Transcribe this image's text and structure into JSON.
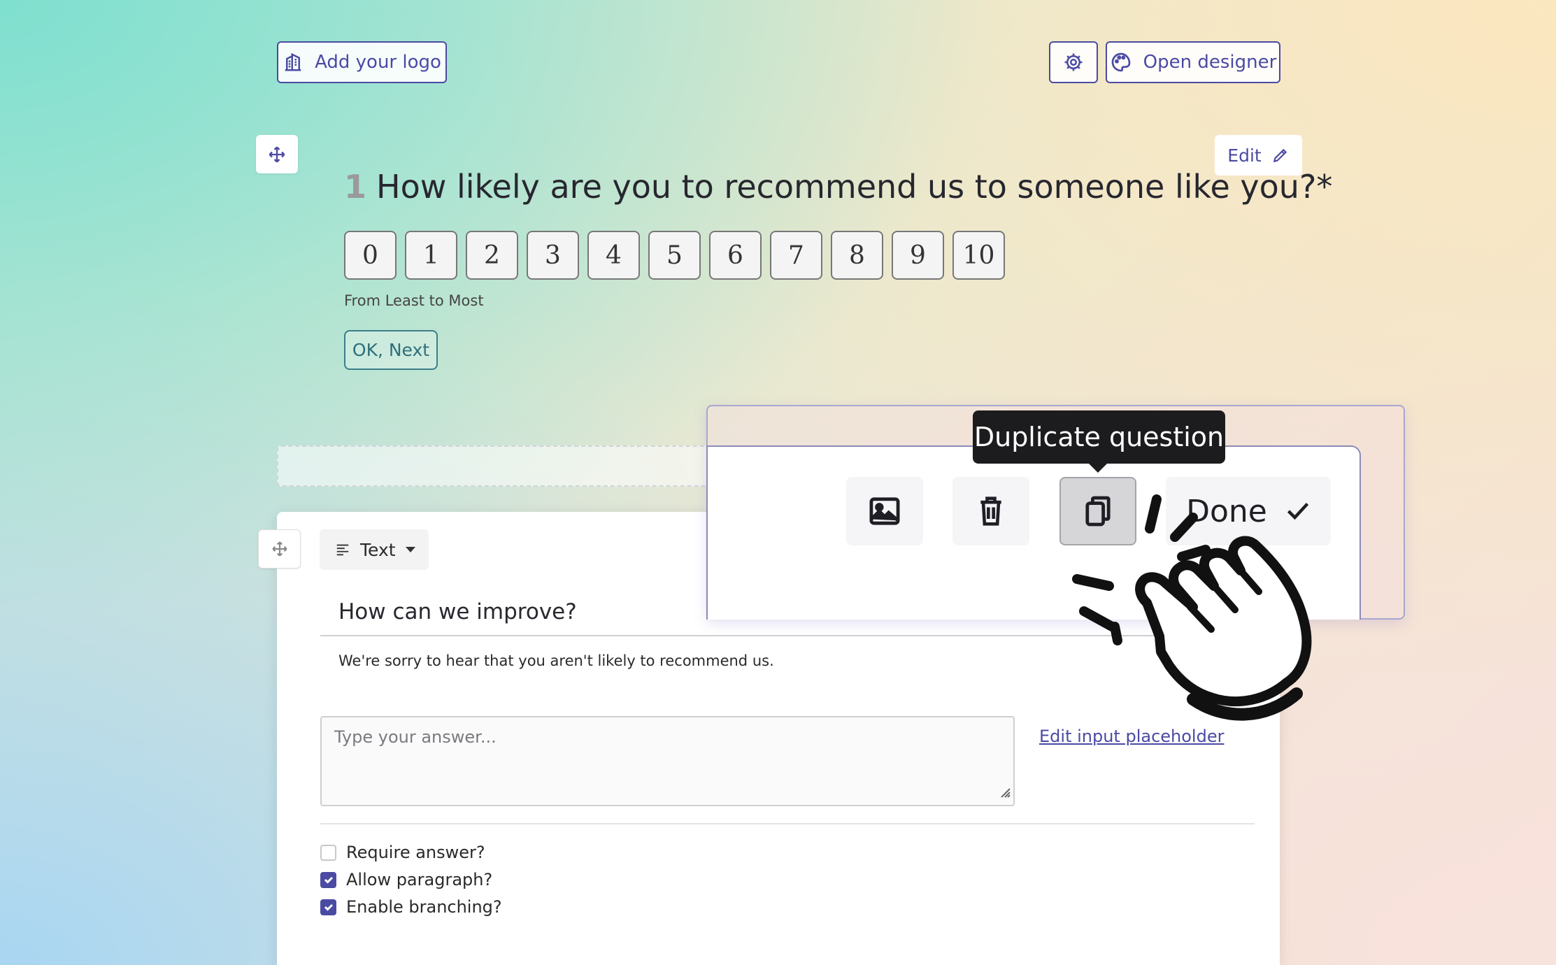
{
  "header": {
    "logo_button": "Add your logo",
    "designer_button": "Open designer"
  },
  "question1": {
    "edit_label": "Edit",
    "number": "1",
    "title": "How likely are you to recommend us to someone like you?*",
    "scale": [
      "0",
      "1",
      "2",
      "3",
      "4",
      "5",
      "6",
      "7",
      "8",
      "9",
      "10"
    ],
    "scale_note": "From Least to Most",
    "next_button": "OK, Next"
  },
  "toolbar": {
    "tooltip": "Duplicate question",
    "done_label": "Done",
    "icons": [
      "image-icon",
      "trash-icon",
      "copy-icon",
      "check-icon"
    ]
  },
  "question2": {
    "type_label": "Text",
    "title": "How can we improve?",
    "description": "We're sorry to hear that you aren't likely to recommend us.",
    "answer_placeholder": "Type your answer...",
    "edit_placeholder_link": "Edit input placeholder",
    "options": [
      {
        "label": "Require answer?",
        "checked": false
      },
      {
        "label": "Allow paragraph?",
        "checked": true
      },
      {
        "label": "Enable branching?",
        "checked": true
      }
    ]
  },
  "colors": {
    "accent": "#4b4aa3",
    "next_button": "#3b7e88",
    "tooltip_bg": "#1c1c1e"
  }
}
